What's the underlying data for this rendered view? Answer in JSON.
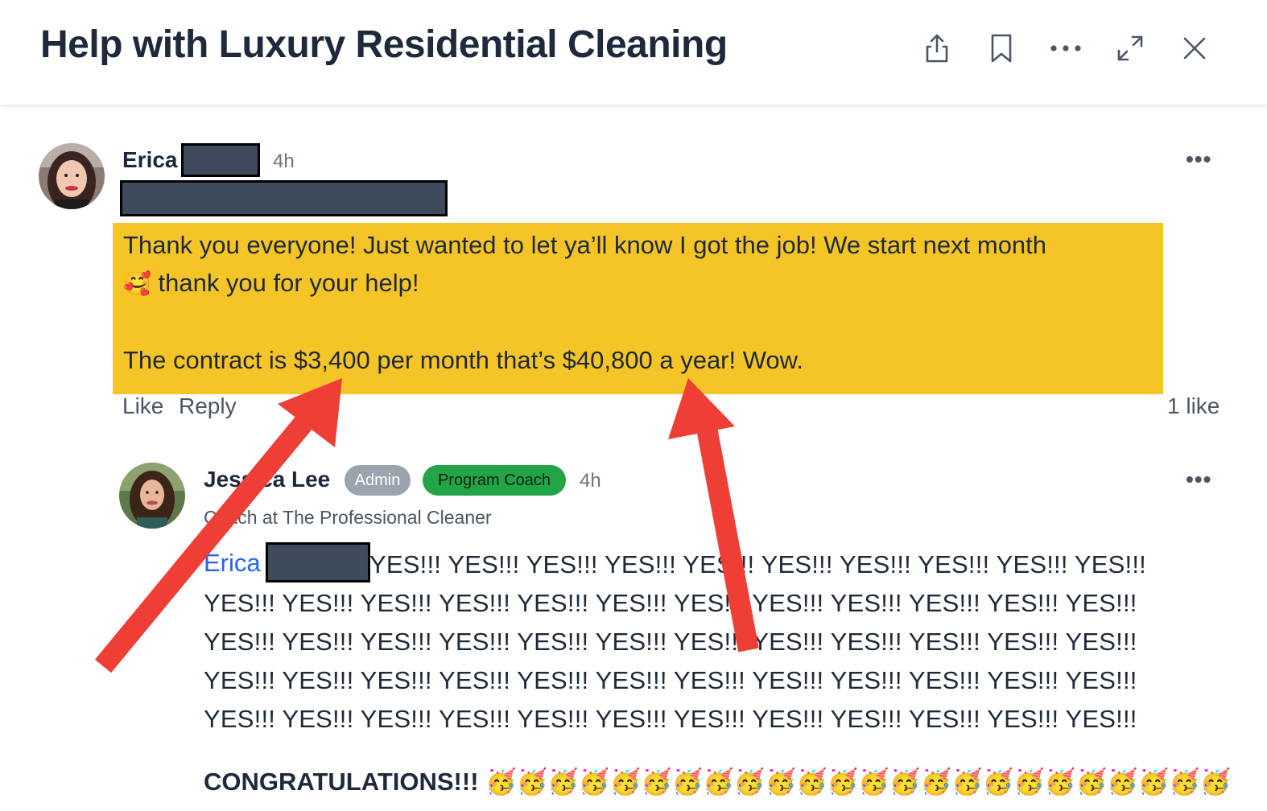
{
  "header": {
    "title": "Help with Luxury Residential Cleaning",
    "icons": [
      "share-icon",
      "bookmark-icon",
      "more-icon",
      "expand-icon",
      "close-icon"
    ]
  },
  "post": {
    "author_first": "Erica",
    "time": "4h",
    "more": "•••",
    "line1": "Thank you everyone! Just wanted to let ya’ll know I got the job! We start next month",
    "line2_emoji": "🥰",
    "line2": " thank you for your help!",
    "line3": "The contract is $3,400 per month that’s $40,800 a year! Wow.",
    "highlight_color": "#f5c427",
    "like_label": "Like",
    "reply_label": "Reply",
    "likes_count": "1 like"
  },
  "reply": {
    "author": "Jessica Lee",
    "badge_admin": "Admin",
    "badge_coach": "Program Coach",
    "time": "4h",
    "subtitle": "Coach at The Professional Cleaner",
    "more": "•••",
    "mention": "Erica",
    "yes_lines": [
      "YES!!! YES!!! YES!!! YES!!! YES!!! YES!!! YES!!! YES!!! YES!!! YES!!!",
      "YES!!! YES!!! YES!!! YES!!! YES!!! YES!!! YES!!! YES!!! YES!!! YES!!! YES!!! YES!!!",
      "YES!!! YES!!! YES!!! YES!!! YES!!! YES!!! YES!!! YES!!! YES!!! YES!!! YES!!! YES!!!",
      "YES!!! YES!!! YES!!! YES!!! YES!!! YES!!! YES!!! YES!!! YES!!! YES!!! YES!!! YES!!!",
      "YES!!! YES!!! YES!!! YES!!! YES!!! YES!!! YES!!! YES!!! YES!!! YES!!! YES!!! YES!!!"
    ],
    "congrats": "CONGRATULATIONS!!! 🥳🥳🥳🥳🥳🥳🥳🥳🥳🥳🥳🥳🥳🥳🥳🥳🥳🥳🥳🥳🥳🥳🥳🥳"
  },
  "colors": {
    "arrow": "#ef3e36",
    "admin_badge": "#9ca3af",
    "coach_badge": "#22a447",
    "mention": "#2563eb"
  }
}
